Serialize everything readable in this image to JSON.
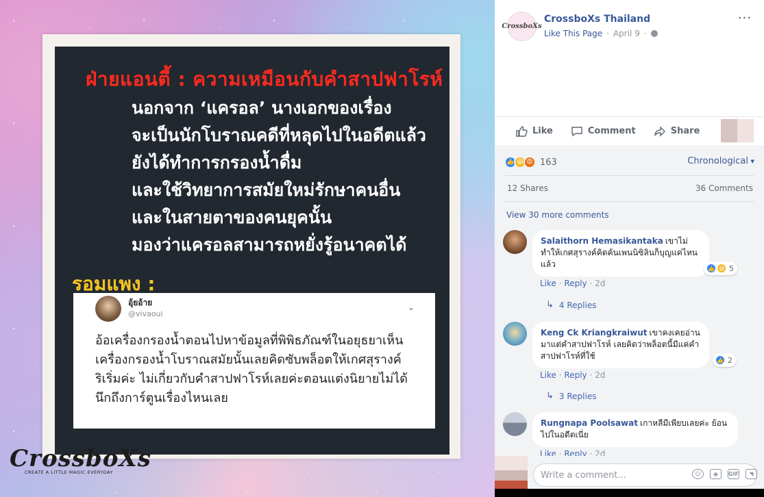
{
  "photo": {
    "title": "ฝ่ายแอนตี้ : ความเหมือนกับคำสาปฟาโรห์",
    "lines": [
      "นอกจาก ‘แครอล’ นางเอกของเรื่อง",
      "จะเป็นนักโบราณคดีที่หลุดไปในอดีตแล้ว",
      "ยังได้ทำการกรองน้ำดื่ม",
      "และใช้วิทยาการสมัยใหม่รักษาคนอื่น",
      "และในสายตาของคนยุคนั้น",
      "มองว่าแครอลสามารถหยั่งรู้อนาคตได้"
    ],
    "subtitle": "รอมแพง :",
    "tweet": {
      "name": "อุ้ยอ้าย",
      "handle": "@vivaoui",
      "body": "อ้อเครื่องกรองน้ำตอนไปหาข้อมูลที่พิพิธภัณฑ์ในอยุธยาเห็นเครื่องกรองน้ำโบราณสมัยนั้นเลยคิดซับพล็อตให้เกศสุรางค์ริเริ่มค่ะ ไม่เกี่ยวกับคำสาปฟาโรห์เลยค่ะตอนแต่งนิยายไม่ได้นึกถึงการ์ตูนเรื่องไหนเลย"
    },
    "logo": "CrossboXs",
    "logo_tag": "CREATE A LITTLE MAGIC EVERYDAY"
  },
  "post": {
    "avatar_text": "CrossboXs",
    "page_name": "CrossboXs Thailand",
    "like_page": "Like This Page",
    "separator": "·",
    "date": "April 9",
    "separator2": "·",
    "more": "···"
  },
  "actions": {
    "like": "Like",
    "comment": "Comment",
    "share": "Share"
  },
  "stats": {
    "reactions_count": "163",
    "sort": "Chronological",
    "shares": "12 Shares",
    "comments": "36 Comments",
    "view_more": "View 30 more comments"
  },
  "comments": [
    {
      "author": "Salaithorn Hemasikantaka",
      "text": "เขาไม่ทำให้เกศสุรางค์คิดค้นเพนนิซิลินก็บุญแค่ไหนแล้ว",
      "reactions": "5",
      "like": "Like",
      "dot": "·",
      "reply": "Reply",
      "dot2": "·",
      "time": "2d",
      "replies": "4 Replies"
    },
    {
      "author": "Keng Ck Kriangkraiwut",
      "text": "เขาคงเคยอ่านมาแต่คำสาปฟาโรห์ เลยคิดว่าพล็อตนี้มีแค่คำสาปฟาโรห์ที่ใช้",
      "reactions": "2",
      "like": "Like",
      "dot": "·",
      "reply": "Reply",
      "dot2": "·",
      "time": "2d",
      "replies": "3 Replies"
    },
    {
      "author": "Rungnapa Poolsawat",
      "text": "เกาหลีมีเพียบเลยค่ะ ย้อนไปในอดีตเนี่ย",
      "like": "Like",
      "dot": "·",
      "reply": "Reply",
      "dot2": "·",
      "time": "2d"
    }
  ],
  "composer": {
    "placeholder": "Write a comment...",
    "gif": "GIF"
  },
  "colors": {
    "link_blue": "#385898",
    "title_red": "#ff2a1f",
    "subtitle_yellow": "#f4c520",
    "board_bg": "#222830",
    "panel_gray": "#f2f3f5"
  }
}
